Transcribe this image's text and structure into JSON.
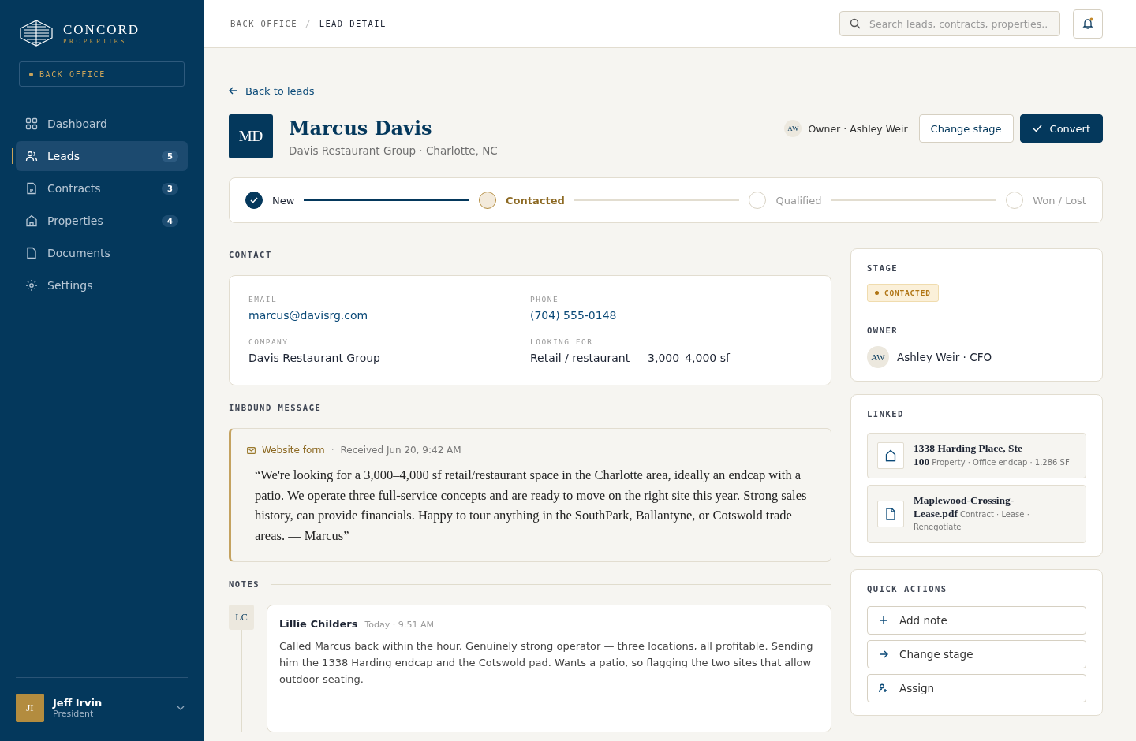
{
  "sidebar": {
    "brand": {
      "name": "CONCORD",
      "tagline": "PROPERTIES"
    },
    "workspace": "BACK OFFICE",
    "items": [
      {
        "label": "Dashboard",
        "selected": false
      },
      {
        "label": "Leads",
        "count": "5",
        "selected": true
      },
      {
        "label": "Contracts",
        "count": "3",
        "selected": false
      },
      {
        "label": "Properties",
        "count": "4",
        "selected": false
      },
      {
        "label": "Documents",
        "selected": false
      },
      {
        "label": "Settings",
        "selected": false
      }
    ],
    "user": {
      "initials": "JI",
      "name": "Jeff Irvin",
      "role": "President"
    }
  },
  "header": {
    "breadcrumb": [
      "BACK OFFICE",
      "/",
      "LEAD DETAIL"
    ],
    "search": {
      "placeholder": "Search leads, contracts, properties..."
    },
    "notifications_unread": true
  },
  "back_link": "Back to leads",
  "lead": {
    "initials": "MD",
    "name": "Marcus Davis",
    "subtitle": "Davis Restaurant Group · Charlotte, NC",
    "owner_initials": "AW",
    "owner": "Owner · Ashley Weir",
    "buttons": [
      "Change stage",
      "Convert"
    ]
  },
  "stages": [
    {
      "label": "New",
      "completed": true,
      "selected": false
    },
    {
      "label": "Contacted",
      "completed": false,
      "selected": true
    },
    {
      "label": "Qualified",
      "completed": false,
      "selected": false
    },
    {
      "label": "Won / Lost",
      "completed": false,
      "selected": false
    }
  ],
  "contact": {
    "title": "CONTACT",
    "fields": [
      {
        "label": "EMAIL",
        "value": "marcus@davisrg.com",
        "link": true
      },
      {
        "label": "PHONE",
        "value": "(704) 555-0148",
        "link": true
      },
      {
        "label": "COMPANY",
        "value": "Davis Restaurant Group",
        "link": false
      },
      {
        "label": "LOOKING FOR",
        "value": "Retail / restaurant — 3,000–4,000 sf",
        "link": false
      }
    ]
  },
  "inbound": {
    "title": "INBOUND MESSAGE",
    "source": "Website form",
    "separator": "·",
    "received": "Received Jun 20, 9:42 AM",
    "message": "“We're looking for a 3,000–4,000 sf retail/restaurant space in the Charlotte area, ideally an endcap with a patio. We operate three full-service concepts and are ready to move on the right site this year. Strong sales history, can provide financials. Happy to tour anything in the SouthPark, Ballantyne, or Cotswold trade areas. — Marcus”"
  },
  "notes": {
    "title": "NOTES",
    "items": [
      {
        "initials": "LC",
        "author": "Lillie Childers",
        "time": "Today · 9:51 AM",
        "text": "Called Marcus back within the hour. Genuinely strong operator — three locations, all profitable. Sending him the 1338 Harding endcap and the Cotswold pad. Wants a patio, so flagging the two sites that allow outdoor seating."
      }
    ]
  },
  "stage_card": {
    "title": "STAGE",
    "badge": "CONTACTED",
    "owner_title": "OWNER",
    "owner_initials": "AW",
    "owner": "Ashley Weir · CFO"
  },
  "linked": {
    "title": "LINKED",
    "items": [
      {
        "kind": "property",
        "title": "1338 Harding Place, Ste 100",
        "meta": "Property · Office endcap · 1,286 SF"
      },
      {
        "kind": "document",
        "title": "Maplewood-Crossing-Lease.pdf",
        "meta": "Contract · Lease · Renegotiate"
      }
    ]
  },
  "quick_actions": {
    "title": "QUICK ACTIONS",
    "items": [
      {
        "kind": "add",
        "label": "Add note"
      },
      {
        "kind": "move",
        "label": "Change stage"
      },
      {
        "kind": "assign",
        "label": "Assign"
      }
    ]
  }
}
